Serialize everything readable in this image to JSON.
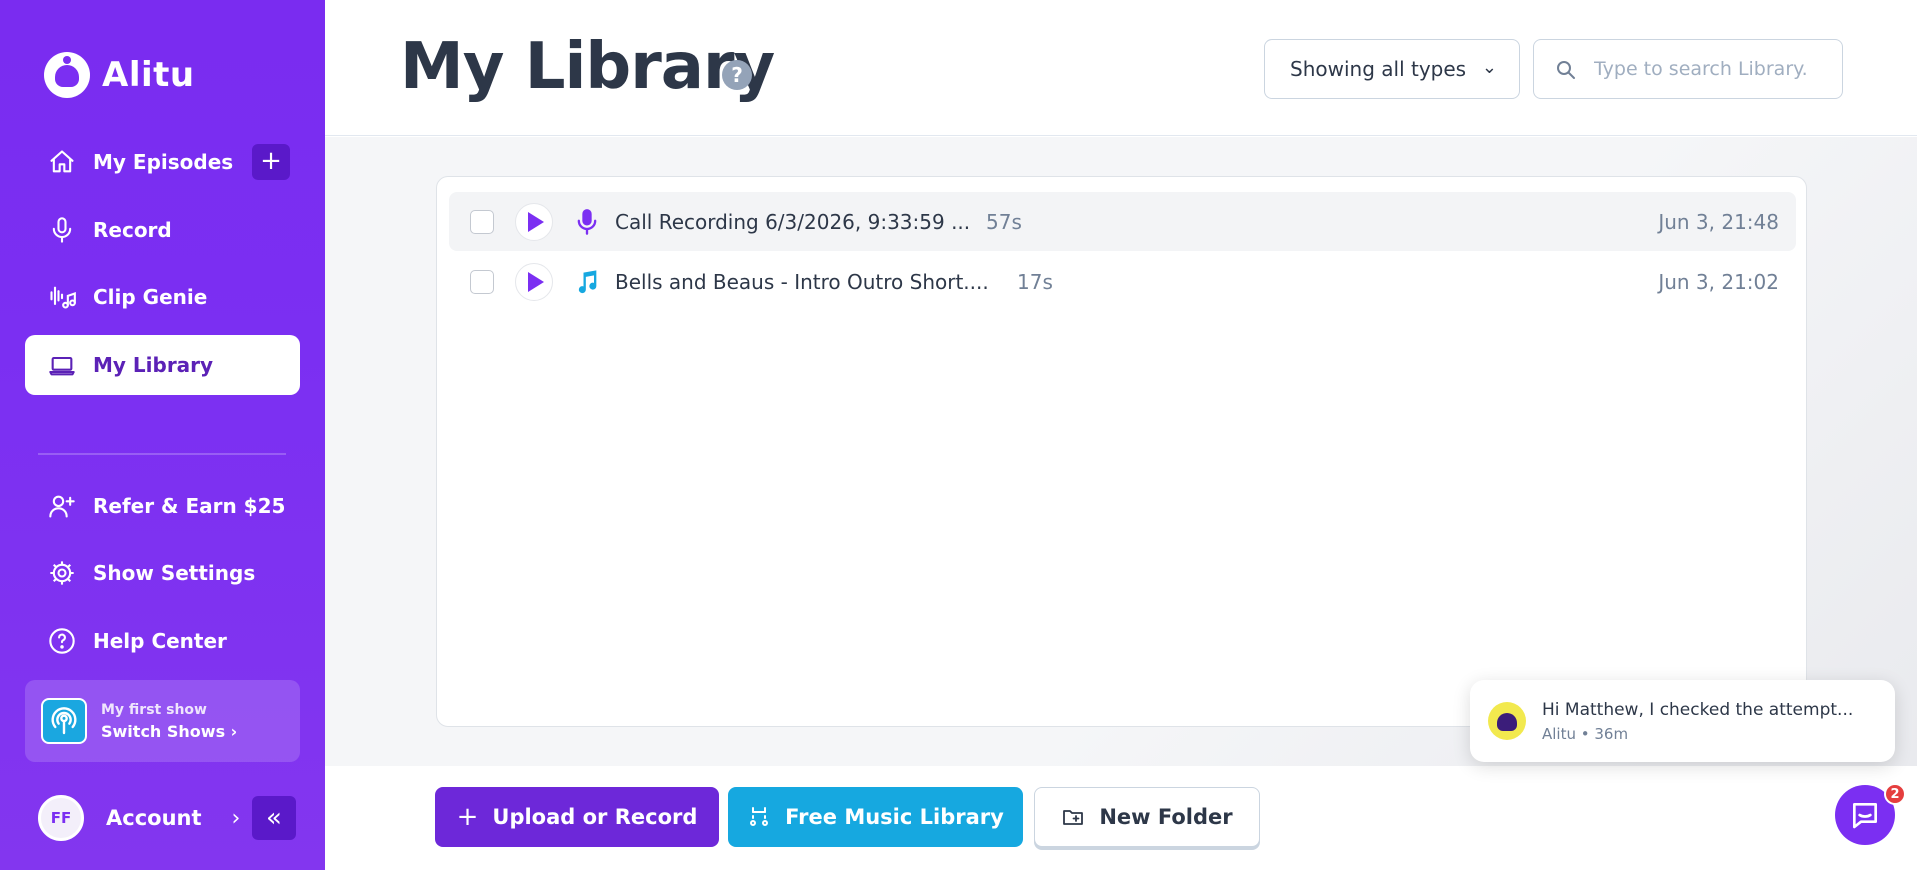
{
  "app": {
    "name": "Alitu",
    "brand_color": "#7b2ff2",
    "accent_blue": "#16a8e0"
  },
  "sidebar": {
    "items": [
      {
        "label": "My Episodes",
        "icon": "home-icon"
      },
      {
        "label": "Record",
        "icon": "microphone-icon"
      },
      {
        "label": "Clip Genie",
        "icon": "clip-genie-icon"
      },
      {
        "label": "My Library",
        "icon": "laptop-icon",
        "active": true
      }
    ],
    "add_episode_symbol": "+",
    "secondary_items": [
      {
        "label": "Refer & Earn $25",
        "icon": "add-user-icon"
      },
      {
        "label": "Show Settings",
        "icon": "gear-icon"
      },
      {
        "label": "Help Center",
        "icon": "help-circle-icon"
      }
    ],
    "show": {
      "name": "My first show",
      "switch_label": "Switch Shows"
    },
    "account": {
      "initials": "FF",
      "label": "Account",
      "chevron": "›"
    },
    "collapse_symbol": "«"
  },
  "header": {
    "title": "My Library",
    "help_symbol": "?",
    "type_filter": {
      "selected": "Showing all types"
    },
    "search": {
      "placeholder": "Type to search Library."
    }
  },
  "library": {
    "rows": [
      {
        "title": "Call Recording 6/3/2026, 9:33:59 ...",
        "duration": "57s",
        "date": "Jun 3, 21:48",
        "type": "microphone-icon"
      },
      {
        "title": "Bells and Beaus - Intro Outro Short....",
        "duration": "17s",
        "date": "Jun 3, 21:02",
        "type": "music-note-icon"
      }
    ]
  },
  "footer": {
    "upload_label": "Upload or Record",
    "music_label": "Free Music Library",
    "folder_label": "New Folder"
  },
  "chat": {
    "message": "Hi Matthew, I checked the attempt...",
    "meta": "Alitu • 36m",
    "badge_count": "2"
  }
}
